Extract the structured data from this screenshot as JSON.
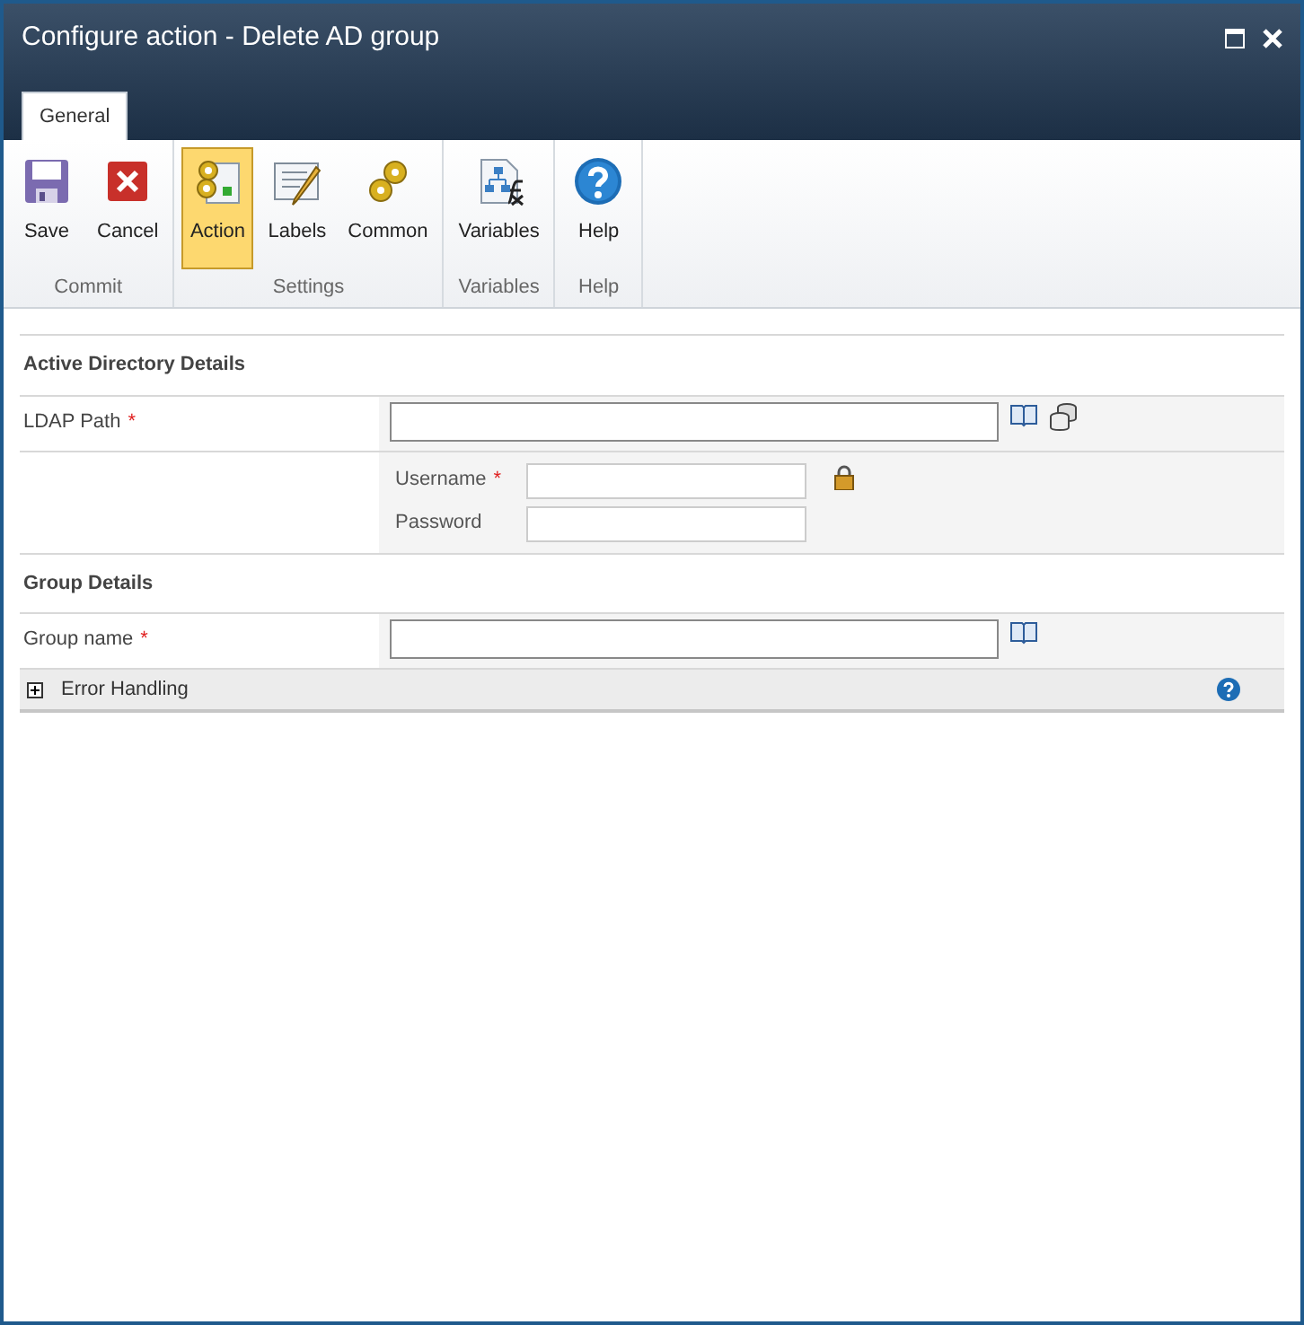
{
  "window": {
    "title": "Configure action - Delete AD group"
  },
  "tabs": [
    {
      "label": "General",
      "selected": true
    }
  ],
  "ribbon": [
    {
      "label": "Commit",
      "buttons": [
        {
          "label": "Save",
          "selected": false
        },
        {
          "label": "Cancel",
          "selected": false
        }
      ]
    },
    {
      "label": "Settings",
      "buttons": [
        {
          "label": "Action",
          "selected": true
        },
        {
          "label": "Labels",
          "selected": false
        },
        {
          "label": "Common",
          "selected": false
        }
      ]
    },
    {
      "label": "Variables",
      "buttons": [
        {
          "label": "Variables",
          "selected": false
        }
      ]
    },
    {
      "label": "Help",
      "buttons": [
        {
          "label": "Help",
          "selected": false
        }
      ]
    }
  ],
  "sections": [
    {
      "title": "Active Directory Details",
      "rows": [
        {
          "kind": "field",
          "label": "LDAP Path",
          "required_mark": "*"
        },
        {
          "kind": "credentials",
          "fields": [
            {
              "label": "Username",
              "required_mark": "*"
            },
            {
              "label": "Password"
            }
          ]
        }
      ]
    },
    {
      "title": "Group Details",
      "rows": [
        {
          "kind": "field",
          "label": "Group name",
          "required_mark": "*"
        }
      ]
    }
  ],
  "error_handling": {
    "label": "Error Handling",
    "expanded": false
  }
}
